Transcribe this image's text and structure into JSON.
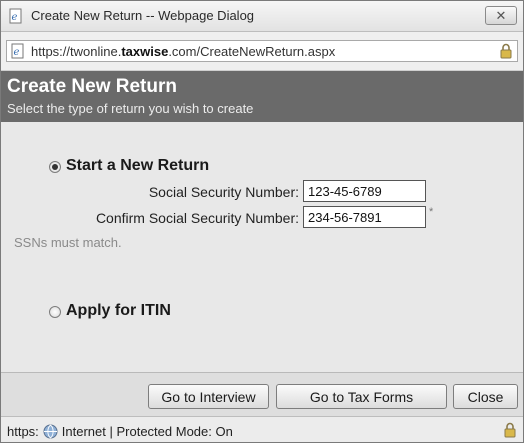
{
  "window": {
    "title": "Create New Return -- Webpage Dialog",
    "close_label": "✕"
  },
  "address_bar": {
    "url_prefix": "https://twonline.",
    "url_domain": "taxwise",
    "url_suffix": ".com/CreateNewReturn.aspx"
  },
  "header": {
    "title": "Create New Return",
    "subtitle": "Select the type of return you wish to create"
  },
  "options": {
    "start_new": {
      "label": "Start a New Return",
      "selected": true,
      "ssn_label": "Social Security Number:",
      "ssn_value": "123-45-6789",
      "confirm_label": "Confirm Social Security Number:",
      "confirm_value": "234-56-7891",
      "required_mark": "*",
      "hint": "SSNs must match."
    },
    "itin": {
      "label": "Apply for ITIN",
      "selected": false
    }
  },
  "buttons": {
    "interview": "Go to Interview",
    "tax_forms": "Go to Tax Forms",
    "close": "Close"
  },
  "status_bar": {
    "protocol": "https:",
    "zone": "Internet | Protected Mode: On"
  },
  "icons": {
    "ie": "ie-page-icon",
    "lock": "lock-icon",
    "globe": "globe-icon"
  }
}
